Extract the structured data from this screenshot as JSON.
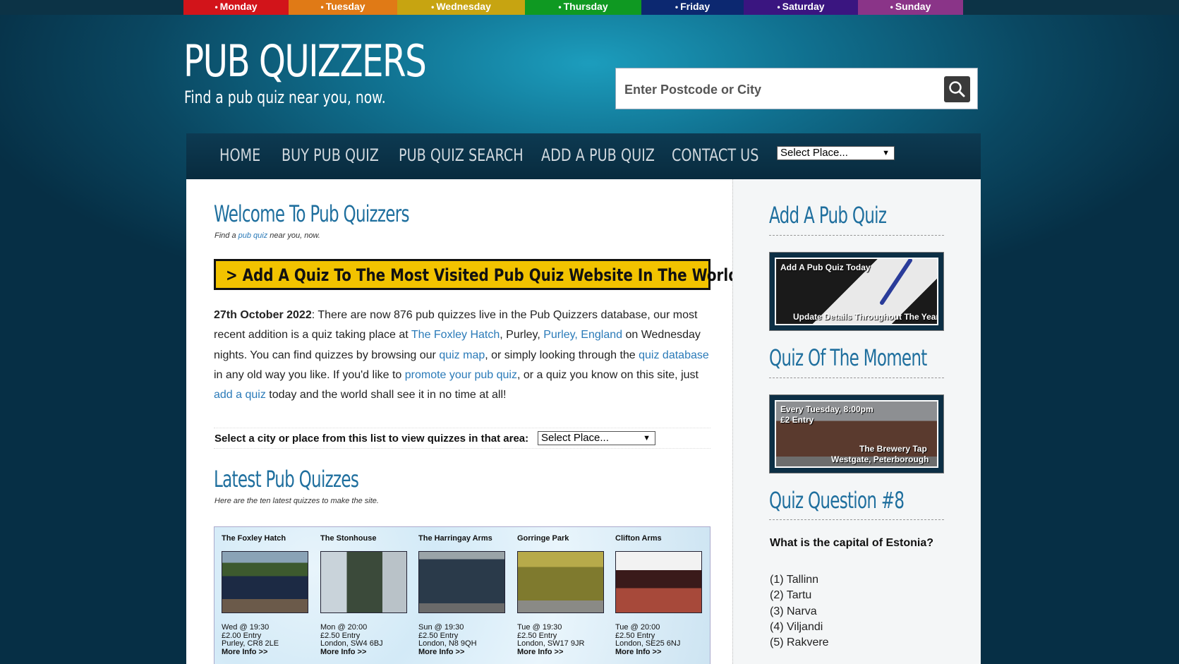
{
  "days": [
    {
      "label": "Monday",
      "color": "#d2141a"
    },
    {
      "label": "Tuesday",
      "color": "#e07a16"
    },
    {
      "label": "Wednesday",
      "color": "#c7a411"
    },
    {
      "label": "Thursday",
      "color": "#0f9922"
    },
    {
      "label": "Friday",
      "color": "#0c2870"
    },
    {
      "label": "Saturday",
      "color": "#3a1580"
    },
    {
      "label": "Sunday",
      "color": "#8a3488"
    }
  ],
  "header": {
    "logo": "PUB QUIZZERS",
    "tagline": "Find a pub quiz near you, now.",
    "search_placeholder": "Enter Postcode or City"
  },
  "nav": {
    "items": [
      "HOME",
      "BUY PUB QUIZ",
      "PUB QUIZ SEARCH",
      "ADD A PUB QUIZ",
      "CONTACT US"
    ],
    "select_value": "Select Place..."
  },
  "welcome": {
    "title": "Welcome To Pub Quizzers",
    "subtitle_pre": "Find a ",
    "subtitle_link": "pub quiz",
    "subtitle_post": " near you, now.",
    "banner": "> Add A Quiz To The Most Visited Pub Quiz Website In The World",
    "date": "27th October 2022",
    "p1": ": There are now 876 pub quizzes live in the Pub Quizzers database, our most recent addition is a quiz taking place at ",
    "link_pub": "The Foxley Hatch",
    "p2": ", Purley, ",
    "link_area": "Purley, England",
    "p3": " on Wednesday nights. You can find quizzes by browsing our ",
    "link_map": "quiz map",
    "p4": ", or simply looking through the ",
    "link_db": "quiz database",
    "p5": " in any old way you like. If you'd like to ",
    "link_promote": "promote your pub quiz",
    "p6": ", or a quiz you know on this site, just ",
    "link_add": "add a quiz",
    "p7": " today and the world shall see it in no time at all!"
  },
  "area_select": {
    "label": "Select a city or place from this list to view quizzes in that area:",
    "value": "Select Place..."
  },
  "latest": {
    "title": "Latest Pub Quizzes",
    "subtitle": "Here are the ten latest quizzes to make the site.",
    "quizzes": [
      {
        "name": "The Foxley Hatch",
        "when": "Wed @ 19:30",
        "entry": "£2.00 Entry",
        "loc": "Purley, CR8 2LE",
        "more": "More Info >>"
      },
      {
        "name": "The Stonhouse",
        "when": "Mon @ 20:00",
        "entry": "£2.50 Entry",
        "loc": "London, SW4 6BJ",
        "more": "More Info >>"
      },
      {
        "name": "The Harringay Arms",
        "when": "Sun @ 19:30",
        "entry": "£2.50 Entry",
        "loc": "London, N8 9QH",
        "more": "More Info >>"
      },
      {
        "name": "Gorringe Park",
        "when": "Tue @ 19:30",
        "entry": "£2.50 Entry",
        "loc": "London, SW17 9JR",
        "more": "More Info >>"
      },
      {
        "name": "Clifton Arms",
        "when": "Tue @ 20:00",
        "entry": "£2.50 Entry",
        "loc": "London, SE25 6NJ",
        "more": "More Info >>"
      }
    ]
  },
  "sidebar": {
    "add_title": "Add A Pub Quiz",
    "add_ad_top": "Add A Pub Quiz Today",
    "add_ad_bottom": "Update Details Throughout The Year",
    "moment_title": "Quiz Of The Moment",
    "moment_l1": "Every Tuesday, 8:00pm",
    "moment_l2": "£2 Entry",
    "moment_l3": "The Brewery Tap",
    "moment_l4": "Westgate, Peterborough",
    "question_title": "Quiz Question #8",
    "question": "What is the capital of Estonia?",
    "options": [
      "(1) Tallinn",
      "(2) Tartu",
      "(3) Narva",
      "(4) Viljandi",
      "(5) Rakvere"
    ]
  }
}
